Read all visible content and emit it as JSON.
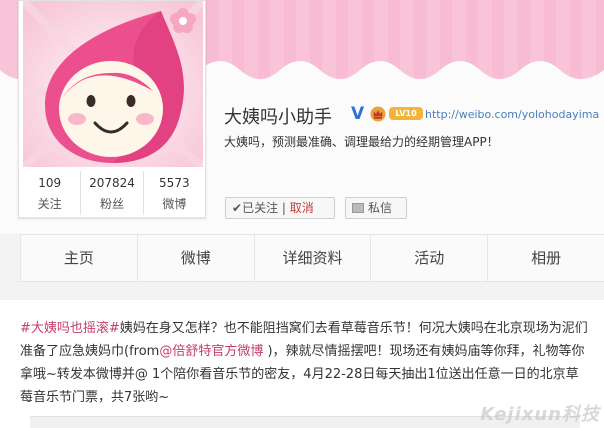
{
  "profile": {
    "name": "大姨吗小助手",
    "verified_badge": "V",
    "level_badge": "LV10",
    "url": "http://weibo.com/yolohodayima",
    "description": "大姨吗，预测最准确、调理最给力的经期管理APP！",
    "stats": [
      {
        "value": "109",
        "label": "关注"
      },
      {
        "value": "207824",
        "label": "粉丝"
      },
      {
        "value": "5573",
        "label": "微博"
      }
    ],
    "follow_check": "✔",
    "follow_label": "已关注",
    "follow_sep": "|",
    "follow_cancel": "取消",
    "message_label": "私信"
  },
  "nav": {
    "tabs": [
      "主页",
      "微博",
      "详细资料",
      "活动",
      "相册"
    ]
  },
  "post": {
    "tag": "#大姨吗也摇滚#",
    "text1": "姨妈在身又怎样？也不能阻挡窝们去看草莓音乐节！何况大姨吗在北京现场为泥们准备了应急姨妈巾(from",
    "mention": "@倍舒特官方微博",
    "text2": " )，辣就尽情摇摆吧！现场还有姨妈庙等你拜，礼物等你拿哦~转发本微博并@ 1个陪你看音乐节的密友，4月22-28日每天抽出1位送出任意一日的北京草莓音乐节门票，共7张哟~"
  },
  "watermark": "Kejixun科技",
  "colors": {
    "banner_pink": "#f9c4d8",
    "accent": "#c43d6b",
    "link_blue": "#4a7fbd"
  }
}
